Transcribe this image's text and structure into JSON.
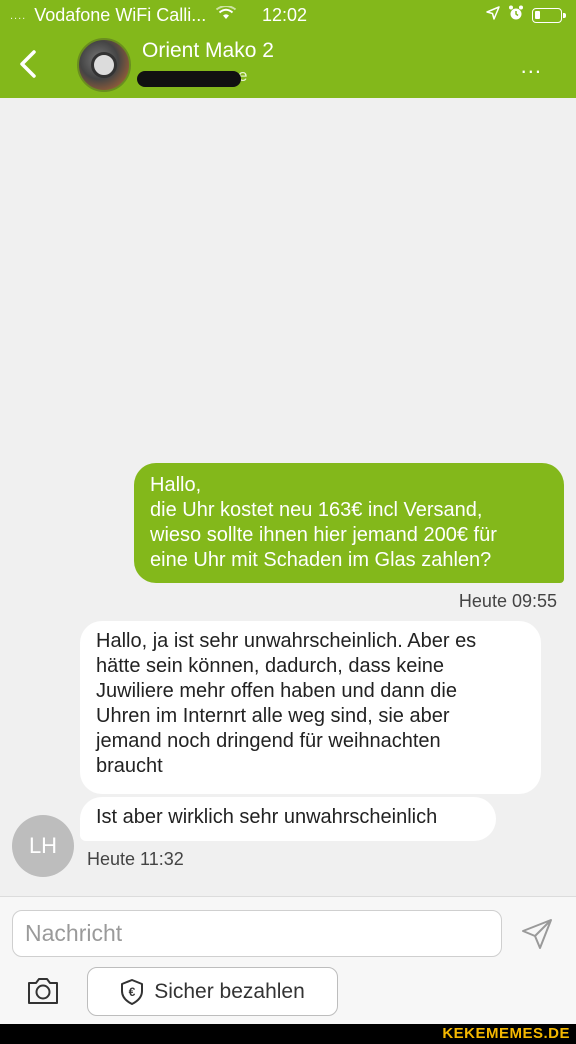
{
  "status_bar": {
    "signal_dots": "....",
    "carrier": "Vodafone WiFi Calli...",
    "time": "12:02",
    "battery_level": 0.22,
    "icons": [
      "wifi-icon",
      "location-arrow-icon",
      "alarm-icon",
      "battery-icon"
    ]
  },
  "header": {
    "contact_name": "Orient Mako 2",
    "contact_subtitle": "e",
    "more": "...",
    "accent_color": "#83b81b"
  },
  "messages": {
    "outgoing": {
      "lines": [
        "Hallo,",
        "die Uhr kostet neu 163€ incl Versand,",
        "wieso sollte ihnen hier jemand 200€ für",
        "eine Uhr mit Schaden im Glas zahlen?"
      ],
      "time": "Heute 09:55"
    },
    "incoming": [
      {
        "lines": [
          "Hallo, ja ist sehr unwahrscheinlich. Aber es",
          "hätte sein können, dadurch, dass keine",
          "Juwiliere mehr offen haben und dann die",
          "Uhren im Internrt alle weg sind, sie aber",
          "jemand noch dringend für weihnachten",
          "braucht"
        ]
      },
      {
        "lines": [
          "Ist aber wirklich sehr unwahrscheinlich"
        ]
      }
    ],
    "incoming_avatar": "LH",
    "incoming_time": "Heute 11:32"
  },
  "composer": {
    "placeholder": "Nachricht",
    "pay_button": "Sicher bezahlen"
  },
  "watermark": "KEKEMEMES.DE"
}
